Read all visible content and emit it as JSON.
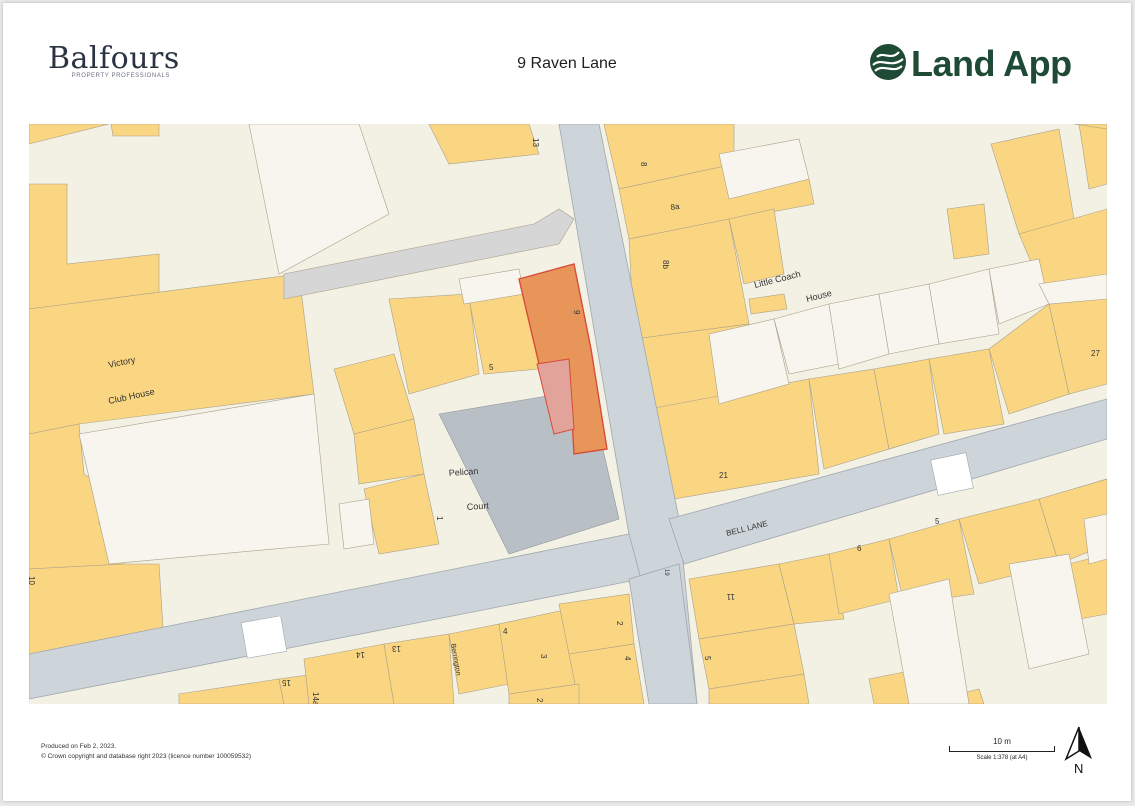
{
  "header": {
    "left_brand": "Balfours",
    "left_tagline": "PROPERTY PROFESSIONALS",
    "title": "9 Raven Lane",
    "right_brand": "Land App"
  },
  "map": {
    "labels": {
      "victory": "Victory",
      "club_house": "Club House",
      "pelican": "Pelican",
      "court": "Court",
      "little_coach": "Little Coach",
      "house": "House",
      "bell_lane": "BELL LANE",
      "berrington": "Berrington"
    },
    "numbers": {
      "n13_top": "13",
      "n8": "8",
      "n8a": "8a",
      "n8b": "8b",
      "n9": "9",
      "n5": "5",
      "n27": "27",
      "n21": "21",
      "n1": "1",
      "n10": "10",
      "n6": "6",
      "n5_bell": "5",
      "n11": "11",
      "n19": "19",
      "n2": "2",
      "n4": "4",
      "n3": "3",
      "n4b": "4",
      "n13": "13",
      "n14": "14",
      "n15": "15",
      "n14a": "14a",
      "n2b": "2",
      "n5b": "5"
    },
    "colors": {
      "building": "#fad682",
      "ground": "#f3f0e4",
      "road": "#cdd4da",
      "plot": "#e8955a",
      "plot_outline": "#d84b3a",
      "plot_inner": "#e2a49a",
      "court": "#b8bfc5"
    }
  },
  "footer": {
    "produced": "Produced on Feb 2, 2023.",
    "copyright": "© Crown copyright and database right 2023 (licence number 100059532)",
    "scale_length": "10 m",
    "scale_ratio": "Scale 1:378 (at A4)",
    "north": "N"
  }
}
